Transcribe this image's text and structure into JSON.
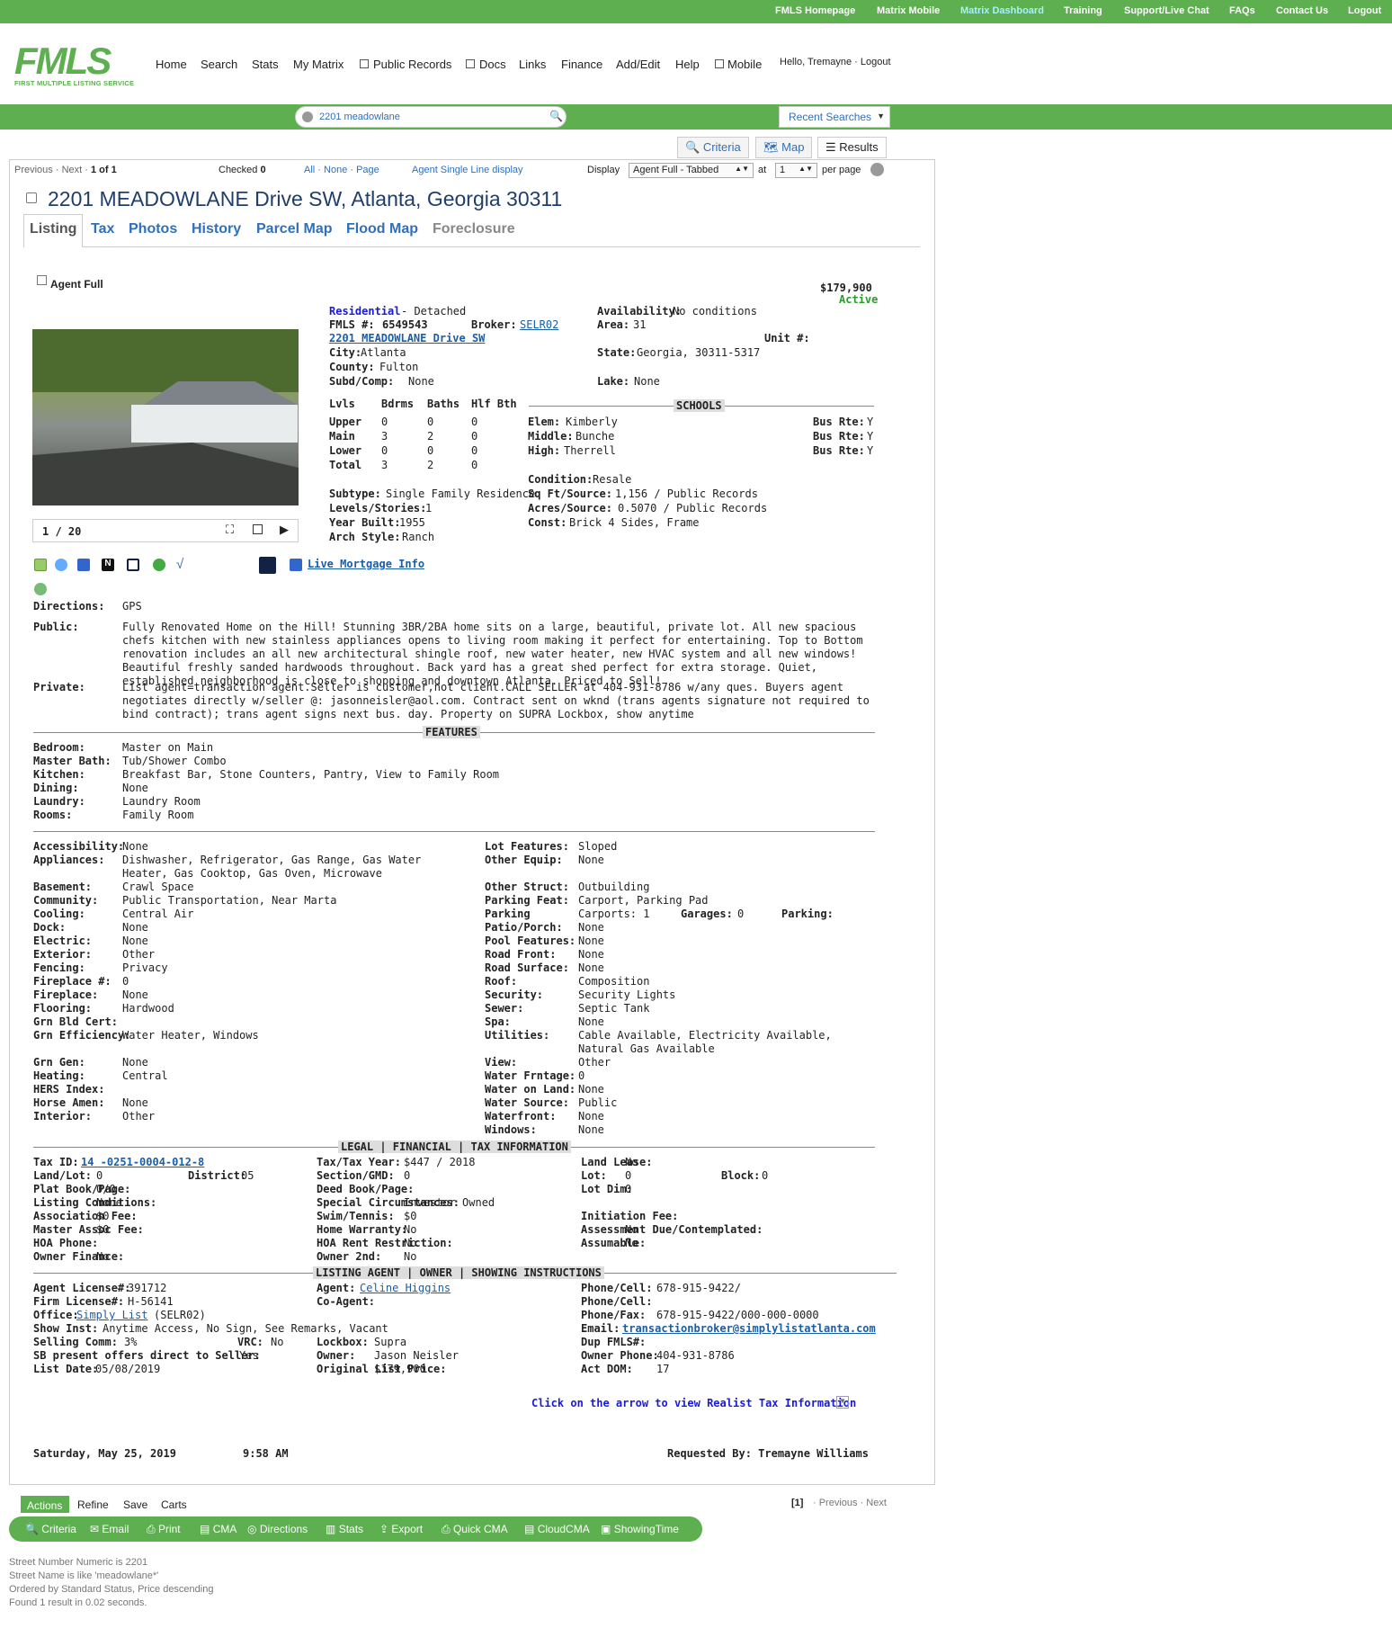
{
  "topnav": [
    "FMLS Homepage",
    "Matrix Mobile",
    "Matrix Dashboard",
    "Training",
    "Support/Live Chat",
    "FAQs",
    "Contact Us",
    "Logout"
  ],
  "logo": {
    "text": "FMLS",
    "sub": "FIRST MULTIPLE LISTING SERVICE"
  },
  "mainnav": [
    "Home",
    "Search",
    "Stats",
    "My Matrix",
    "Public Records",
    "Docs",
    "Links",
    "Finance",
    "Add/Edit",
    "Help",
    "Mobile"
  ],
  "user": "Hello, Tremayne · Logout",
  "search": {
    "value": "2201 meadowlane"
  },
  "recent": "Recent Searches",
  "viewtabs": [
    "Criteria",
    "Map",
    "Results"
  ],
  "pager": {
    "prevnext": "Previous · Next ·",
    "count": "1",
    "of": "of 1",
    "checked_label": "Checked",
    "checked": "0",
    "all": "All",
    "none": "None",
    "page": "Page",
    "single": "Agent Single Line display",
    "display": "Display",
    "display_val": "Agent Full - Tabbed",
    "at": "at",
    "at_val": "1",
    "perpage": "per page"
  },
  "address": "2201 MEADOWLANE Drive SW, Atlanta, Georgia 30311",
  "dtabs": [
    "Listing",
    "Tax",
    "Photos",
    "History",
    "Parcel Map",
    "Flood Map",
    "Foreclosure"
  ],
  "agentfull": "Agent Full",
  "price": "$179,900",
  "status": "Active",
  "photo_counter": "1 / 20",
  "mortgage": "Live Mortgage Info",
  "info": {
    "type": "Residential",
    "subtype_hd": "- Detached",
    "fmls_lbl": "FMLS #:",
    "fmls": "6549543",
    "broker_lbl": "Broker:",
    "broker": "SELR02",
    "street": "2201 MEADOWLANE Drive SW",
    "city_lbl": "City:",
    "city": "Atlanta",
    "county_lbl": "County:",
    "county": "Fulton",
    "subd_lbl": "Subd/Comp:",
    "subd": "None",
    "avail_lbl": "Availability:",
    "avail": "No conditions",
    "area_lbl": "Area:",
    "area": "31",
    "unit_lbl": "Unit #:",
    "state_lbl": "State:",
    "state": "Georgia, 30311-5317",
    "lake_lbl": "Lake:",
    "lake": "None"
  },
  "rooms": {
    "headers": [
      "Lvls",
      "Bdrms",
      "Baths",
      "Hlf Bth"
    ],
    "rows": [
      [
        "Upper",
        "0",
        "0",
        "0"
      ],
      [
        "Main",
        "3",
        "2",
        "0"
      ],
      [
        "Lower",
        "0",
        "0",
        "0"
      ],
      [
        "Total",
        "3",
        "2",
        "0"
      ]
    ]
  },
  "schools": {
    "title": "SCHOOLS",
    "rows": [
      [
        "Elem:",
        "Kimberly",
        "Bus Rte:",
        "Y"
      ],
      [
        "Middle:",
        "Bunche",
        "Bus Rte:",
        "Y"
      ],
      [
        "High:",
        "Therrell",
        "Bus Rte:",
        "Y"
      ]
    ]
  },
  "props1": [
    [
      "Subtype:",
      "Single Family Residence"
    ],
    [
      "Levels/Stories:",
      "1"
    ],
    [
      "Year Built:",
      "1955"
    ],
    [
      "Arch Style:",
      "Ranch"
    ]
  ],
  "props2": [
    [
      "Condition:",
      "Resale"
    ],
    [
      "Sq Ft/Source:",
      "1,156 / Public Records"
    ],
    [
      "Acres/Source:",
      "0.5070 / Public Records"
    ],
    [
      "Const:",
      "Brick 4 Sides, Frame"
    ]
  ],
  "directions_lbl": "Directions:",
  "directions": "GPS",
  "public_lbl": "Public:",
  "public": "Fully Renovated Home on the Hill! Stunning 3BR/2BA home sits on a large, beautiful, private lot. All new spacious chefs kitchen with new stainless appliances opens to living room making it perfect for entertaining. Top to Bottom renovation includes an all new architectural shingle roof, new water heater, new HVAC system and all new windows! Beautiful freshly sanded hardwoods throughout. Back yard has a great shed perfect for extra storage. Quiet, established neighborhood is close to shopping and downtown Atlanta. Priced to Sell!",
  "private_lbl": "Private:",
  "private": "List agent=transaction agent.Seller is customer,not client.CALL SELLER at 404-931-8786 w/any ques. Buyers agent negotiates directly w/seller @: jasonneisler@aol.com. Contract sent on wknd (trans agents signature not required to bind contract); trans agent signs next bus. day. Property on SUPRA Lockbox, show anytime",
  "features_title": "FEATURES",
  "features1": [
    [
      "Bedroom:",
      "Master on Main"
    ],
    [
      "Master Bath:",
      "Tub/Shower Combo"
    ],
    [
      "Kitchen:",
      "Breakfast Bar, Stone Counters, Pantry, View to Family Room"
    ],
    [
      "Dining:",
      "None"
    ],
    [
      "Laundry:",
      "Laundry Room"
    ],
    [
      "Rooms:",
      "Family Room"
    ]
  ],
  "featL": [
    [
      "Accessibility:",
      "None"
    ],
    [
      "Appliances:",
      "Dishwasher, Refrigerator, Gas Range, Gas Water Heater, Gas Cooktop, Gas Oven, Microwave"
    ],
    [
      "Basement:",
      "Crawl Space"
    ],
    [
      "Community:",
      "Public Transportation, Near Marta"
    ],
    [
      "Cooling:",
      "Central Air"
    ],
    [
      "Dock:",
      "None"
    ],
    [
      "Electric:",
      "None"
    ],
    [
      "Exterior:",
      "Other"
    ],
    [
      "Fencing:",
      "Privacy"
    ],
    [
      "Fireplace #:",
      "0"
    ],
    [
      "Fireplace:",
      "None"
    ],
    [
      "Flooring:",
      "Hardwood"
    ],
    [
      "Grn Bld Cert:",
      ""
    ],
    [
      "Grn Efficiency:",
      "Water Heater, Windows"
    ],
    [
      "Grn Gen:",
      "None"
    ],
    [
      "Heating:",
      "Central"
    ],
    [
      "HERS Index:",
      ""
    ],
    [
      "Horse Amen:",
      "None"
    ],
    [
      "Interior:",
      "Other"
    ]
  ],
  "featR": [
    [
      "Lot Features:",
      "Sloped"
    ],
    [
      "Other Equip:",
      "None"
    ],
    [
      "Other Struct:",
      "Outbuilding"
    ],
    [
      "Parking Feat:",
      "Carport, Parking Pad"
    ],
    [
      "Parking",
      "Carports: 1"
    ],
    [
      "Patio/Porch:",
      "None"
    ],
    [
      "Pool Features:",
      "None"
    ],
    [
      "Road Front:",
      "None"
    ],
    [
      "Road Surface:",
      "None"
    ],
    [
      "Roof:",
      "Composition"
    ],
    [
      "Security:",
      "Security Lights"
    ],
    [
      "Sewer:",
      "Septic Tank"
    ],
    [
      "Spa:",
      "None"
    ],
    [
      "Utilities:",
      "Cable Available, Electricity Available, Natural Gas Available"
    ],
    [
      "View:",
      "Other"
    ],
    [
      "Water Frntage:",
      "0"
    ],
    [
      "Water on Land:",
      "None"
    ],
    [
      "Water Source:",
      "Public"
    ],
    [
      "Waterfront:",
      "None"
    ],
    [
      "Windows:",
      "None"
    ]
  ],
  "garages_lbl": "Garages:",
  "garages": "0",
  "parking2_lbl": "Parking:",
  "legal_title": "LEGAL | FINANCIAL | TAX INFORMATION",
  "taxid_lbl": "Tax ID:",
  "taxid": "14 -0251-0004-012-8",
  "legalA": [
    [
      "Land/Lot:",
      "0"
    ],
    [
      "Plat Book/Page:",
      "0/0"
    ],
    [
      "Listing Conditions:",
      "None"
    ],
    [
      "Association Fee:",
      "$0"
    ],
    [
      "Master Assoc Fee:",
      "$0"
    ],
    [
      "HOA Phone:",
      ""
    ],
    [
      "Owner Finance:",
      "No"
    ]
  ],
  "district_lbl": "District:",
  "district": "05",
  "legalB": [
    [
      "Tax/Tax Year:",
      "$447 / 2018"
    ],
    [
      "Section/GMD:",
      "0"
    ],
    [
      "Deed Book/Page:",
      ""
    ],
    [
      "Special Circumstances:",
      "Investor Owned"
    ],
    [
      "Swim/Tennis:",
      "$0"
    ],
    [
      "Home Warranty:",
      "No"
    ],
    [
      "HOA Rent Restriction:",
      "No"
    ],
    [
      "Owner 2nd:",
      "No"
    ]
  ],
  "legalC": [
    [
      "Land Lease:",
      "No"
    ],
    [
      "Lot:",
      "0"
    ],
    [
      "Lot Dim:",
      "0"
    ],
    [
      "Initiation Fee:",
      ""
    ],
    [
      "Assessment Due/Contemplated:",
      "No"
    ],
    [
      "Assumable:",
      "No"
    ]
  ],
  "block_lbl": "Block:",
  "block": "0",
  "agent_title": "LISTING AGENT | OWNER | SHOWING INSTRUCTIONS",
  "agentA": [
    [
      "Agent License#:",
      "391712"
    ],
    [
      "Firm License#:",
      "H-56141"
    ]
  ],
  "office_lbl": "Office:",
  "office": "Simply List",
  "office_code": "(SELR02)",
  "showinst_lbl": "Show Inst:",
  "showinst": "Anytime Access, No Sign, See Remarks, Vacant",
  "selling_lbl": "Selling Comm:",
  "selling": "3%",
  "vrc_lbl": "VRC:",
  "vrc": "No",
  "sb_lbl": "SB present offers direct to Seller:",
  "sb": "Yes",
  "listdate_lbl": "List Date:",
  "listdate": "05/08/2019",
  "agent_lbl": "Agent:",
  "agent": "Celine Higgins",
  "coagent_lbl": "Co-Agent:",
  "agentB": [
    [
      "Lockbox:",
      "Supra"
    ],
    [
      "Owner:",
      "Jason Neisler"
    ],
    [
      "Original List Price:",
      "$179,900"
    ]
  ],
  "agentC": [
    [
      "Phone/Cell:",
      "678-915-9422/"
    ],
    [
      "Phone/Cell:",
      ""
    ],
    [
      "Phone/Fax:",
      "678-915-9422/000-000-0000"
    ]
  ],
  "email_lbl": "Email:",
  "email": "transactionbroker@simplylistatlanta.com",
  "agentC2": [
    [
      "Dup FMLS#:",
      ""
    ],
    [
      "Owner Phone:",
      "404-931-8786"
    ],
    [
      "Act DOM:",
      "17"
    ]
  ],
  "realist": "Click on the arrow to view Realist Tax Information",
  "date": "Saturday, May 25, 2019",
  "time": "9:58 AM",
  "requested": "Requested By: Tremayne Williams",
  "actions": [
    "Actions",
    "Refine",
    "Save",
    "Carts"
  ],
  "bottom_pager": {
    "page": "[1]",
    "nav": "· Previous · Next"
  },
  "pills": [
    "Criteria",
    "Email",
    "Print",
    "CMA",
    "Directions",
    "Stats",
    "Export",
    "Quick CMA",
    "CloudCMA",
    "ShowingTime"
  ],
  "footer": [
    "Street Number Numeric is 2201",
    "Street Name is like 'meadowlane*'",
    "Ordered by Standard Status, Price descending",
    "Found 1 result in 0.02 seconds."
  ],
  "colors": {
    "green": "#5daf4f",
    "blue": "#3170b9"
  }
}
